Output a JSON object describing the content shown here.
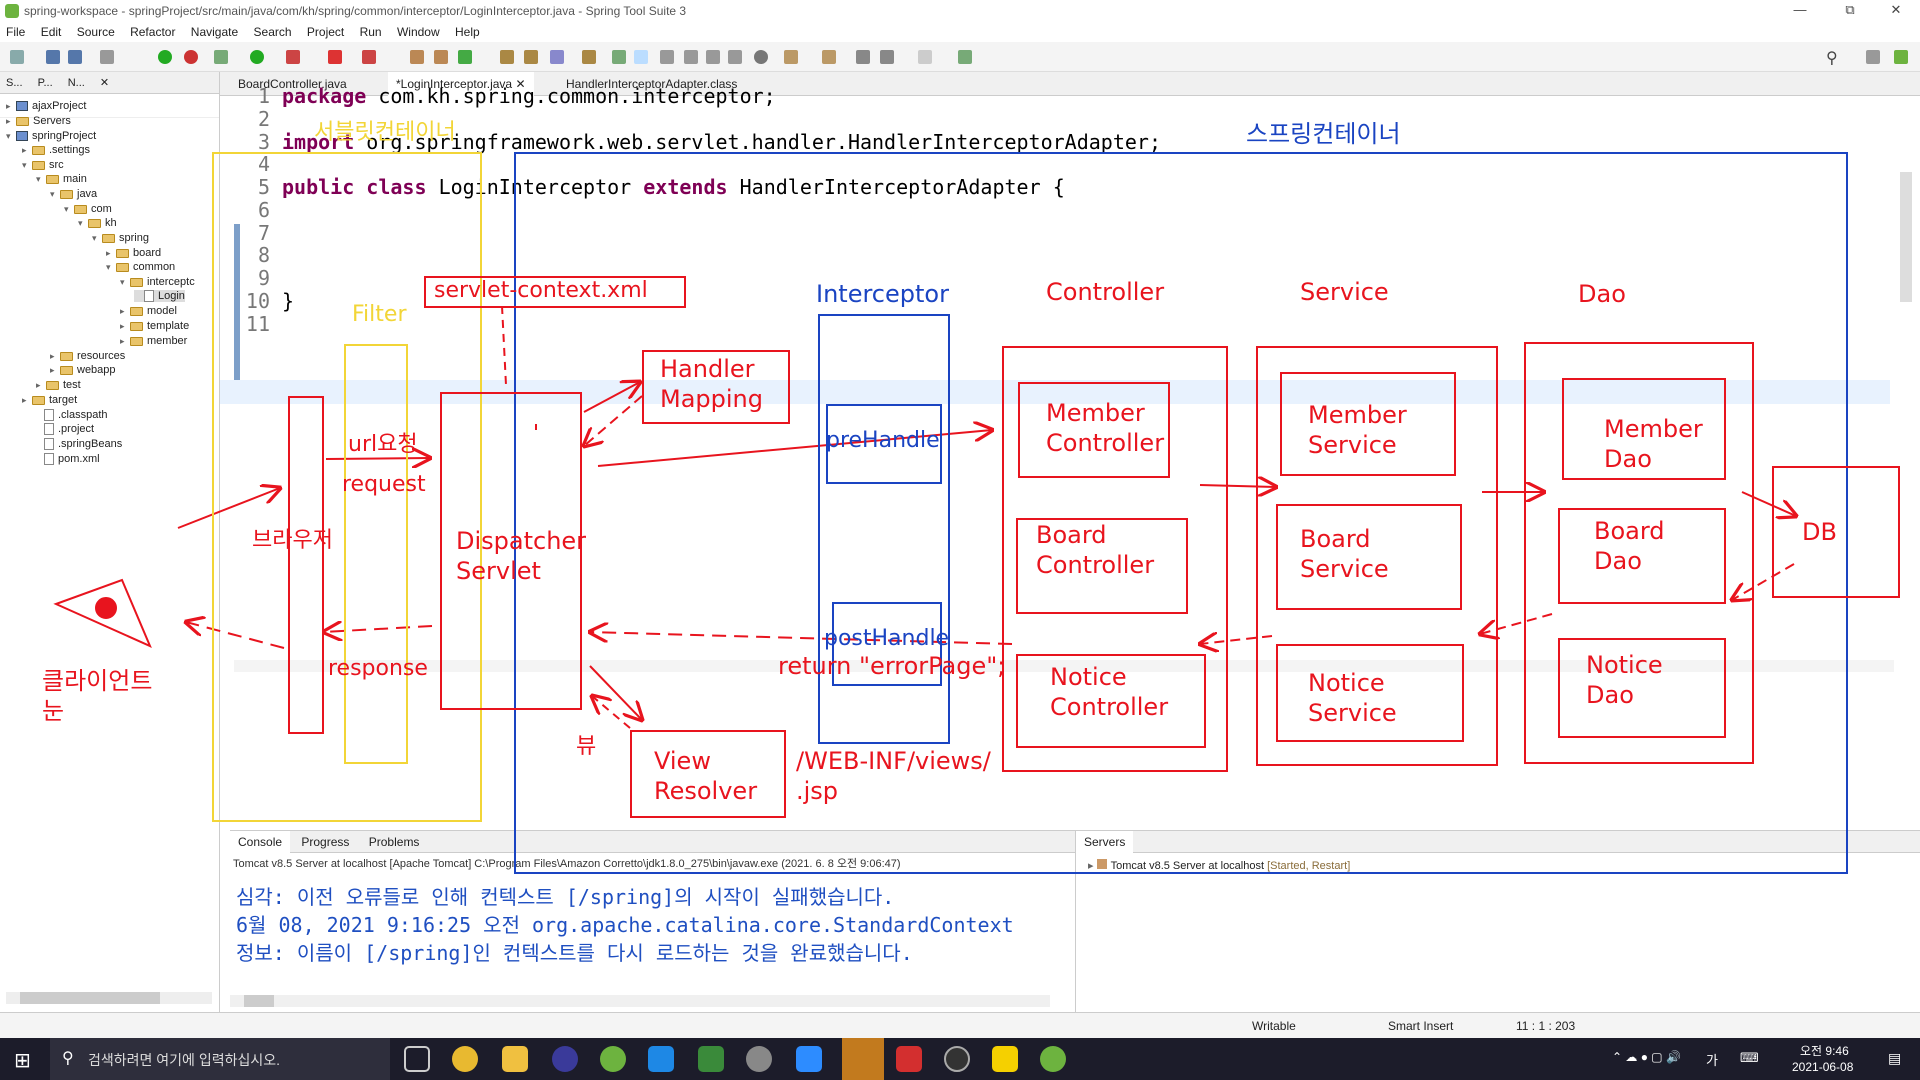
{
  "window": {
    "title": "spring-workspace - springProject/src/main/java/com/kh/spring/common/interceptor/LoginInterceptor.java - Spring Tool Suite 3"
  },
  "menu": [
    "File",
    "Edit",
    "Source",
    "Refactor",
    "Navigate",
    "Search",
    "Project",
    "Run",
    "Window",
    "Help"
  ],
  "left_tabs": [
    "S...",
    "P...",
    "N..."
  ],
  "tree": [
    {
      "label": "ajaxProject"
    },
    {
      "label": "Servers"
    },
    {
      "label": "springProject"
    },
    {
      "label": ".settings"
    },
    {
      "label": "src"
    },
    {
      "label": "main"
    },
    {
      "label": "java"
    },
    {
      "label": "com"
    },
    {
      "label": "kh"
    },
    {
      "label": "spring"
    },
    {
      "label": "board"
    },
    {
      "label": "common"
    },
    {
      "label": "interceptc"
    },
    {
      "label": "Login"
    },
    {
      "label": "model"
    },
    {
      "label": "template"
    },
    {
      "label": "member"
    },
    {
      "label": "resources"
    },
    {
      "label": "webapp"
    },
    {
      "label": "test"
    },
    {
      "label": "target"
    },
    {
      "label": ".classpath"
    },
    {
      "label": ".project"
    },
    {
      "label": ".springBeans"
    },
    {
      "label": "pom.xml"
    }
  ],
  "editor_tabs": [
    "BoardController.java",
    "*LoginInterceptor.java",
    "HandlerInterceptorAdapter.class"
  ],
  "code_lines": [
    {
      "n": "1",
      "text": "package com.kh.spring.common.interceptor;"
    },
    {
      "n": "2",
      "text": ""
    },
    {
      "n": "3",
      "text": "import org.springframework.web.servlet.handler.HandlerInterceptorAdapter;"
    },
    {
      "n": "4",
      "text": ""
    },
    {
      "n": "5",
      "text": "public class LoginInterceptor extends HandlerInterceptorAdapter {"
    },
    {
      "n": "6",
      "text": ""
    },
    {
      "n": "7",
      "text": ""
    },
    {
      "n": "8",
      "text": ""
    },
    {
      "n": "9",
      "text": ""
    },
    {
      "n": "10",
      "text": "}"
    },
    {
      "n": "11",
      "text": ""
    }
  ],
  "console": {
    "tabs": [
      "Console",
      "Progress",
      "Problems"
    ],
    "header": "Tomcat v8.5 Server at localhost [Apache Tomcat] C:\\Program Files\\Amazon Corretto\\jdk1.8.0_275\\bin\\javaw.exe  (2021. 6. 8 오전 9:06:47)",
    "lines": [
      "심각: 이전 오류들로 인해 컨텍스트 [/spring]의 시작이 실패했습니다.",
      "6월 08, 2021 9:16:25 오전 org.apache.catalina.core.StandardContext",
      "정보: 이름이 [/spring]인 컨텍스트를 다시 로드하는 것을 완료했습니다."
    ]
  },
  "servers": {
    "tab": "Servers",
    "row": "Tomcat v8.5 Server at localhost",
    "status": "[Started, Restart]"
  },
  "status": {
    "writable": "Writable",
    "insert": "Smart Insert",
    "position": "11 : 1 : 203"
  },
  "taskbar": {
    "search_placeholder": "검색하려면 여기에 입력하십시오.",
    "time": "오전 9:46",
    "date": "2021-06-08",
    "ime": "가"
  },
  "annotations": {
    "servlet_container": "서블릿컨테이너",
    "spring_container": "스프링컨테이너",
    "servlet_context": "servlet-context.xml",
    "filter": "Filter",
    "interceptor": "Interceptor",
    "controller": "Controller",
    "service": "Service",
    "dao": "Dao",
    "handler_mapping": [
      "Handler",
      "Mapping"
    ],
    "url_request": "url요청",
    "request": "request",
    "browser": "브라우저",
    "dispatcher": [
      "Dispatcher",
      "Servlet"
    ],
    "response": "response",
    "client_eye": [
      "클라이언트",
      "눈"
    ],
    "view": "뷰",
    "view_resolver": [
      "View",
      "Resolver"
    ],
    "view_path": [
      "/WEB-INF/views/",
      ".jsp"
    ],
    "prehandle": "preHandle",
    "posthandle": "postHandle",
    "return_error": "return \"errorPage\";",
    "member_controller": [
      "Member",
      "Controller"
    ],
    "board_controller": [
      "Board",
      "Controller"
    ],
    "notice_controller": [
      "Notice",
      "Controller"
    ],
    "member_service": [
      "Member",
      "Service"
    ],
    "board_service": [
      "Board",
      "Service"
    ],
    "notice_service": [
      "Notice",
      "Service"
    ],
    "member_dao": [
      "Member",
      "Dao"
    ],
    "board_dao": [
      "Board",
      "Dao"
    ],
    "notice_dao": [
      "Notice",
      "Dao"
    ],
    "db": "DB"
  },
  "colors": {
    "annotation_red": "#e8141e",
    "annotation_blue": "#1a44c2",
    "annotation_yellow": "#f2d537",
    "keyword": "#7f0055"
  }
}
